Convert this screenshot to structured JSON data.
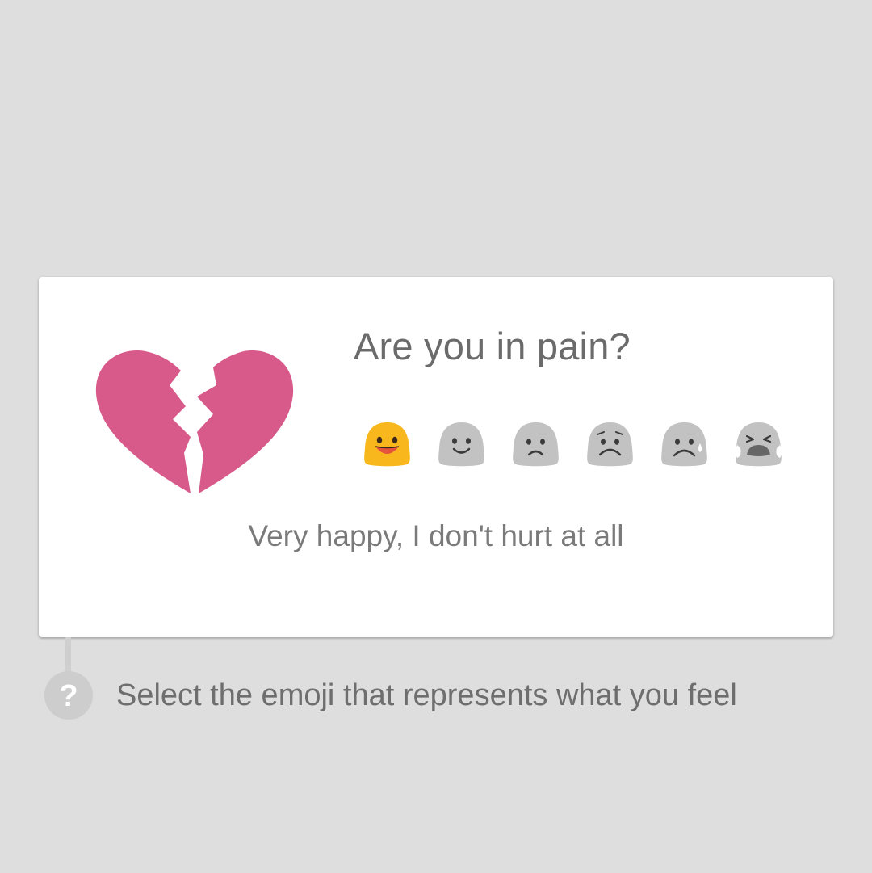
{
  "card": {
    "icon": "broken-heart-icon",
    "question": "Are you in pain?",
    "selected_answer": "Very happy, I don't hurt at all",
    "emojis": [
      {
        "icon": "very-happy-emoji-icon",
        "selected": true
      },
      {
        "icon": "happy-emoji-icon",
        "selected": false
      },
      {
        "icon": "slightly-sad-emoji-icon",
        "selected": false
      },
      {
        "icon": "worried-emoji-icon",
        "selected": false
      },
      {
        "icon": "crying-emoji-icon",
        "selected": false
      },
      {
        "icon": "loudly-crying-emoji-icon",
        "selected": false
      }
    ]
  },
  "hint": {
    "icon": "question-mark-icon",
    "text": "Select the emoji that represents what you feel"
  },
  "colors": {
    "background": "#dedede",
    "card": "#ffffff",
    "heart": "#d75a8a",
    "selected_emoji": "#f8b81d",
    "unselected_emoji": "#c2c2c2",
    "text": "#6b6b6b"
  }
}
